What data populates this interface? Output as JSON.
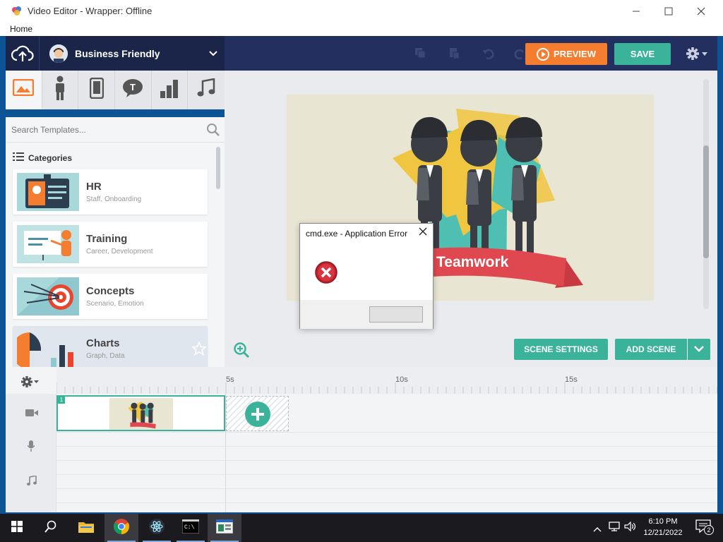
{
  "window": {
    "title": "Video Editor - Wrapper: Offline",
    "minimize": "—",
    "maximize": "☐",
    "close": "✕"
  },
  "menu": {
    "home": "Home"
  },
  "header": {
    "theme_name": "Business Friendly",
    "preview_label": "PREVIEW",
    "save_label": "SAVE"
  },
  "assets": {
    "tabs": [
      "image-icon",
      "character-icon",
      "device-icon",
      "text-bubble-icon",
      "chart-icon",
      "music-icon"
    ],
    "search_placeholder": "Search Templates...",
    "categories_label": "Categories",
    "categories": [
      {
        "name": "HR",
        "sub": "Staff, Onboarding"
      },
      {
        "name": "Training",
        "sub": "Career, Development"
      },
      {
        "name": "Concepts",
        "sub": "Scenario, Emotion"
      },
      {
        "name": "Charts",
        "sub": "Graph, Data"
      }
    ]
  },
  "stage": {
    "banner_text": "Teamwork",
    "scene_settings_label": "SCENE SETTINGS",
    "add_scene_label": "ADD SCENE"
  },
  "timeline": {
    "ticks": [
      "5s",
      "10s",
      "15s"
    ],
    "scene_number": "1"
  },
  "dialog": {
    "title": "cmd.exe - Application Error",
    "close": "✕",
    "button_label": ""
  },
  "taskbar": {
    "time": "6:10 PM",
    "date": "12/21/2022",
    "notification_count": "2"
  },
  "colors": {
    "accent": "#3bb39a",
    "preview": "#f47d30",
    "header": "#232f5e"
  }
}
